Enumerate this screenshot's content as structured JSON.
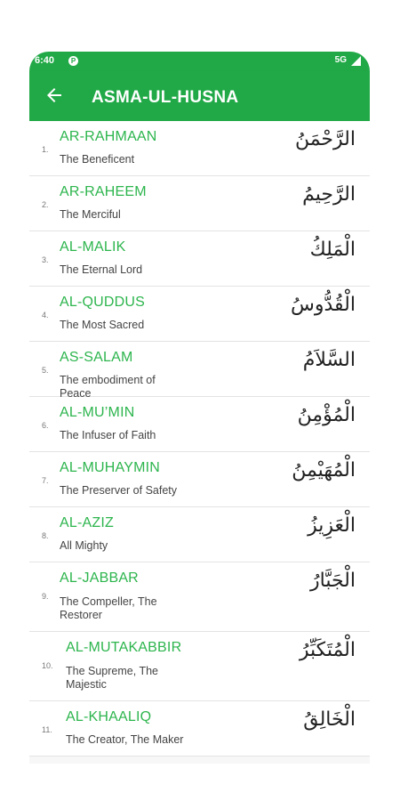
{
  "status": {
    "time": "6:40",
    "network": "5G"
  },
  "appbar": {
    "title": "ASMA-UL-HUSNA"
  },
  "names": [
    {
      "num": "1.",
      "name": "AR-RAHMAAN",
      "meaning": "The Beneficent",
      "arabic": "الرَّحْمَنُ"
    },
    {
      "num": "2.",
      "name": "AR-RAHEEM",
      "meaning": "The Merciful",
      "arabic": "الرَّحِيمُ"
    },
    {
      "num": "3.",
      "name": "AL-MALIK",
      "meaning": "The Eternal Lord",
      "arabic": "الْمَلِكُ"
    },
    {
      "num": "4.",
      "name": "AL-QUDDUS",
      "meaning": "The Most Sacred",
      "arabic": "الْقُدُّوسُ"
    },
    {
      "num": "5.",
      "name": "AS-SALAM",
      "meaning": "The embodiment of Peace",
      "arabic": "السَّلاَمُ"
    },
    {
      "num": "6.",
      "name": "AL-MU’MIN",
      "meaning": "The Infuser of Faith",
      "arabic": "الْمُؤْمِنُ"
    },
    {
      "num": "7.",
      "name": "AL-MUHAYMIN",
      "meaning": "The Preserver of Safety",
      "arabic": "الْمُهَيْمِنُ"
    },
    {
      "num": "8.",
      "name": "AL-AZIZ",
      "meaning": "All Mighty",
      "arabic": "الْعَزِيزُ"
    },
    {
      "num": "9.",
      "name": "AL-JABBAR",
      "meaning": "The Compeller, The Restorer",
      "arabic": "الْجَبَّارُ"
    },
    {
      "num": "10.",
      "name": "AL-MUTAKABBIR",
      "meaning": "The Supreme, The Majestic",
      "arabic": "الْمُتَكَبِّرُ"
    },
    {
      "num": "11.",
      "name": "AL-KHAALIQ",
      "meaning": "The Creator, The Maker",
      "arabic": "الْخَالِقُ"
    }
  ]
}
